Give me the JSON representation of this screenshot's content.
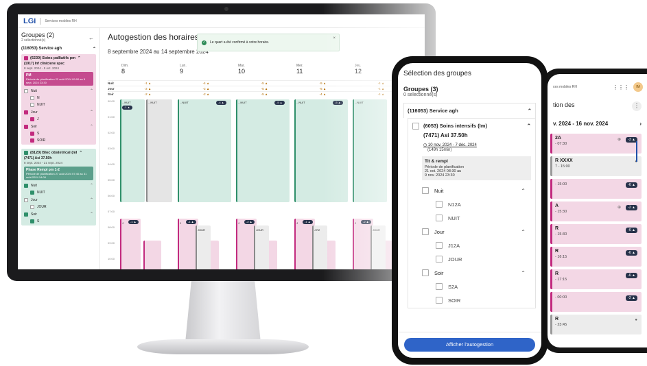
{
  "desktop": {
    "brand": "LGi",
    "app_subtitle": "Services mobiles RH",
    "sidebar": {
      "title": "Groupes (2)",
      "selected": "2 sélectionné(s)",
      "back_icon": "arrow-left-icon",
      "service": "(116053) Service agh",
      "groups": [
        {
          "title": "(6230) Soins palliatifs pm",
          "subtitle": "(1917) Inf cliniciene spec",
          "dates": "8 sept. 2024 - 5 oct. 2024",
          "phase_title": "PM",
          "phase_text": "Période de planification 22 août 2024 09:00 au 5 sept. 2024 23:30",
          "color": "#f3d7e5",
          "shifts": [
            {
              "label": "Nuit",
              "checked": false,
              "items": [
                {
                  "label": "N",
                  "checked": false
                },
                {
                  "label": "NUIT",
                  "checked": false
                }
              ]
            },
            {
              "label": "Jour",
              "checked": true,
              "items": [
                {
                  "label": "J",
                  "checked": true
                }
              ]
            },
            {
              "label": "Soir",
              "checked": true,
              "items": [
                {
                  "label": "S",
                  "checked": true
                },
                {
                  "label": "SOIR",
                  "checked": true
                }
              ]
            }
          ]
        },
        {
          "title": "(8120) Bloc obstetrical (ml",
          "subtitle": "(7471) Asi 37.50h",
          "dates": "8 sept. 2024 - 21 sept. 2024",
          "phase_title": "Phase Rempl pm 1-2",
          "phase_text": "Période de planification 27 août 2024 07:40 au 31 août 2024 14:00",
          "color": "#d4ebe3",
          "shifts": [
            {
              "label": "Nuit",
              "checked": true,
              "items": [
                {
                  "label": "NUIT",
                  "checked": true
                }
              ]
            },
            {
              "label": "Jour",
              "checked": false,
              "items": [
                {
                  "label": "JOUR",
                  "checked": false
                }
              ]
            },
            {
              "label": "Soir",
              "checked": true,
              "items": [
                {
                  "label": "S",
                  "checked": true
                }
              ]
            }
          ]
        }
      ]
    },
    "main": {
      "title": "Autogestion des horaires",
      "range": "8 septembre 2024 au 14 septembre 2024",
      "toast": "Le quart a été confirmé à votre horaire.",
      "days": [
        {
          "dow": "Dim.",
          "num": "8"
        },
        {
          "dow": "Lun.",
          "num": "9"
        },
        {
          "dow": "Mar.",
          "num": "10"
        },
        {
          "dow": "Mer.",
          "num": "11"
        },
        {
          "dow": "Jeu.",
          "num": "12"
        }
      ],
      "summary": [
        {
          "label": "Nuit",
          "values": [
            "-1 ▲",
            "-4 ▲",
            "-5 ▲",
            "-5 ▲",
            "-4 ▲"
          ]
        },
        {
          "label": "Jour",
          "values": [
            "-2 ▲",
            "-2 ▲",
            "-5 ▲",
            "-5 ▲",
            "-4 ▲"
          ]
        },
        {
          "label": "Soir",
          "values": [
            "-2 ▲",
            "-2 ▲",
            "-5 ▲",
            "-4 ▲",
            "-4 ▲"
          ]
        }
      ],
      "hours": [
        "00:00",
        "01:00",
        "02:00",
        "03:00",
        "04:00",
        "05:00",
        "06:00",
        "07:00",
        "08:00",
        "09:00",
        "10:00"
      ],
      "columns": [
        {
          "label": "...NUIT",
          "badge": "-1 ▲",
          "color": "#d4ebe3"
        },
        {
          "label": "...NUIT",
          "badge": "",
          "color": "#e5e5e5"
        },
        {
          "label": "...NUIT",
          "badge": "-4 ▲",
          "color": "#d4ebe3"
        },
        {
          "label": "...NUIT",
          "badge": "-5 ▲",
          "color": "#d4ebe3"
        },
        {
          "label": "...NUIT",
          "badge": "-5 ▲",
          "color": "#d4ebe3"
        },
        {
          "label": "...NUIT",
          "badge": "",
          "color": "#d4ebe3"
        }
      ],
      "day_shifts": [
        {
          "label": "J",
          "badge": "-1 ▲"
        },
        {
          "label": "J",
          "badge": "-1 ▲"
        },
        {
          "label": "J",
          "badge": "-2 ▲"
        },
        {
          "label": "J",
          "badge": "-1 ▲"
        },
        {
          "label": "J",
          "badge": "-2 ▲"
        }
      ],
      "extra_labels": [
        "JOUR",
        "JOUR",
        "J R2",
        "JOUR"
      ]
    }
  },
  "phone": {
    "title": "Sélection des groupes",
    "groups_title": "Groupes (3)",
    "selected": "0 selectionné(s)",
    "service": "(116053) Service agh",
    "group_title": "(6053) Soins intensifs (Im)",
    "group_sub": "(7471) Asi 37.50h",
    "group_dates": "10 nov. 2024 - 7 déc. 2024",
    "group_duration": "(149h 15min)",
    "plan_title": "Tit & rempl",
    "plan_lines": [
      "Période de planification",
      "21 oct. 2024 08:30 au",
      "9 nov. 2024 23:30"
    ],
    "shifts": [
      {
        "label": "Nuit",
        "items": [
          "N12A",
          "NUIT"
        ]
      },
      {
        "label": "Jour",
        "items": [
          "J12A",
          "JOUR"
        ]
      },
      {
        "label": "Soir",
        "items": [
          "S2A",
          "SOIR"
        ]
      }
    ],
    "button": "Afficher l'autogestion"
  },
  "phone2": {
    "app_subtitle": "ces mobiles RH",
    "avatar": "IM",
    "title": "tion des",
    "range": "v. 2024 - 16 nov. 2024",
    "cards": [
      {
        "l1": "2A",
        "l2": "- 07:30",
        "badge": "-3 ▲",
        "style": "pink",
        "icon": "⊕"
      },
      {
        "l1": "R XXXX",
        "l2": "7 - 15:00",
        "badge": "",
        "style": "grey",
        "icon": "●"
      },
      {
        "l1": "",
        "l2": "- 15:00",
        "badge": "-6 ▲",
        "style": "pink",
        "icon": ""
      },
      {
        "l1": "A",
        "l2": "- 15:30",
        "badge": "-2 ▲",
        "style": "pink",
        "icon": "⊕"
      },
      {
        "l1": "R",
        "l2": "- 15:30",
        "badge": "-6 ▲",
        "style": "pink",
        "icon": ""
      },
      {
        "l1": "R",
        "l2": "- 16:15",
        "badge": "-6 ▲",
        "style": "pink",
        "icon": ""
      },
      {
        "l1": "R",
        "l2": "- 17:15",
        "badge": "-6 ▲",
        "style": "pink",
        "icon": ""
      },
      {
        "l1": "",
        "l2": "- 00:00",
        "badge": "-2 ▲",
        "style": "pink",
        "icon": ""
      },
      {
        "l1": "R",
        "l2": "- 23:45",
        "badge": "",
        "style": "grey",
        "icon": "●"
      }
    ]
  },
  "colors": {
    "accent": "#1f4fa8",
    "pink": "#c22a7e",
    "green": "#2f8f6a",
    "badge": "#28334b"
  }
}
